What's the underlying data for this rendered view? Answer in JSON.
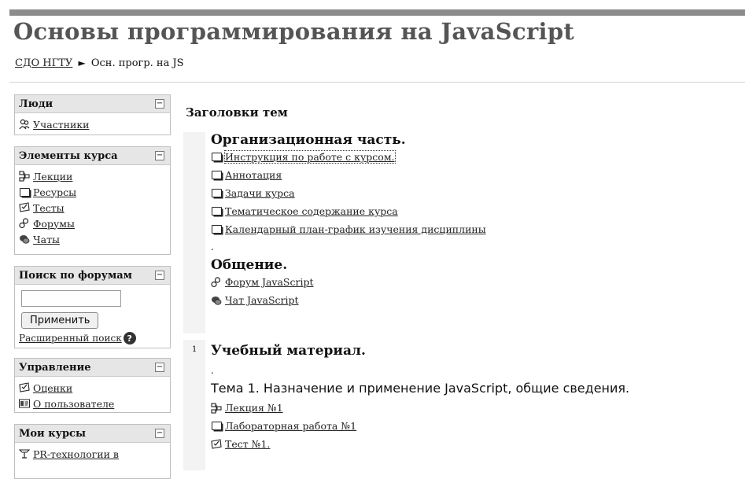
{
  "header": {
    "title": "Основы программирования на JavaScript",
    "breadcrumb": {
      "home": "СДО НГТУ",
      "separator": "►",
      "current": "Осн. прогр. на JS"
    }
  },
  "sidebar": {
    "people": {
      "title": "Люди",
      "toggle": "−",
      "items": [
        {
          "label": "Участники",
          "icon": "participants-icon"
        }
      ]
    },
    "elements": {
      "title": "Элементы курса",
      "toggle": "−",
      "items": [
        {
          "label": "Лекции",
          "icon": "lecture-icon"
        },
        {
          "label": "Ресурсы",
          "icon": "resource-icon"
        },
        {
          "label": "Тесты",
          "icon": "quiz-icon"
        },
        {
          "label": "Форумы",
          "icon": "forum-icon"
        },
        {
          "label": "Чаты",
          "icon": "chat-icon"
        }
      ]
    },
    "forum_search": {
      "title": "Поиск по форумам",
      "toggle": "−",
      "input_value": "",
      "button": "Применить",
      "advanced": "Расширенный поиск"
    },
    "admin": {
      "title": "Управление",
      "toggle": "−",
      "items": [
        {
          "label": "Оценки",
          "icon": "grades-icon"
        },
        {
          "label": "О пользователе",
          "icon": "profile-icon"
        }
      ]
    },
    "my_courses": {
      "title": "Мои курсы",
      "toggle": "−",
      "items": [
        {
          "label": "PR-технологии в",
          "icon": "course-icon"
        }
      ]
    }
  },
  "main": {
    "heading": "Заголовки тем",
    "section0": {
      "title": "Организационная часть.",
      "links": [
        "Инструкция по работе с курсом.",
        "Аннотация",
        "Задачи курса",
        "Тематическое содержание курса",
        "Календарный план-график изучения дисциплины"
      ],
      "dot": ".",
      "sub_title": "Общение.",
      "sub_links": [
        {
          "label": "Форум JavaScript",
          "icon": "forum-icon"
        },
        {
          "label": "Чат JavaScript",
          "icon": "chat-icon"
        }
      ]
    },
    "section1": {
      "number": "1",
      "title": "Учебный материал.",
      "dot": ".",
      "topic": "Тема 1. Назначение и применение JavaScript, общие сведения.",
      "links": [
        {
          "label": "Лекция №1",
          "icon": "lecture-icon"
        },
        {
          "label": "Лабораторная работа №1",
          "icon": "resource-icon"
        },
        {
          "label": "Тест №1.",
          "icon": "quiz-icon"
        }
      ]
    }
  }
}
